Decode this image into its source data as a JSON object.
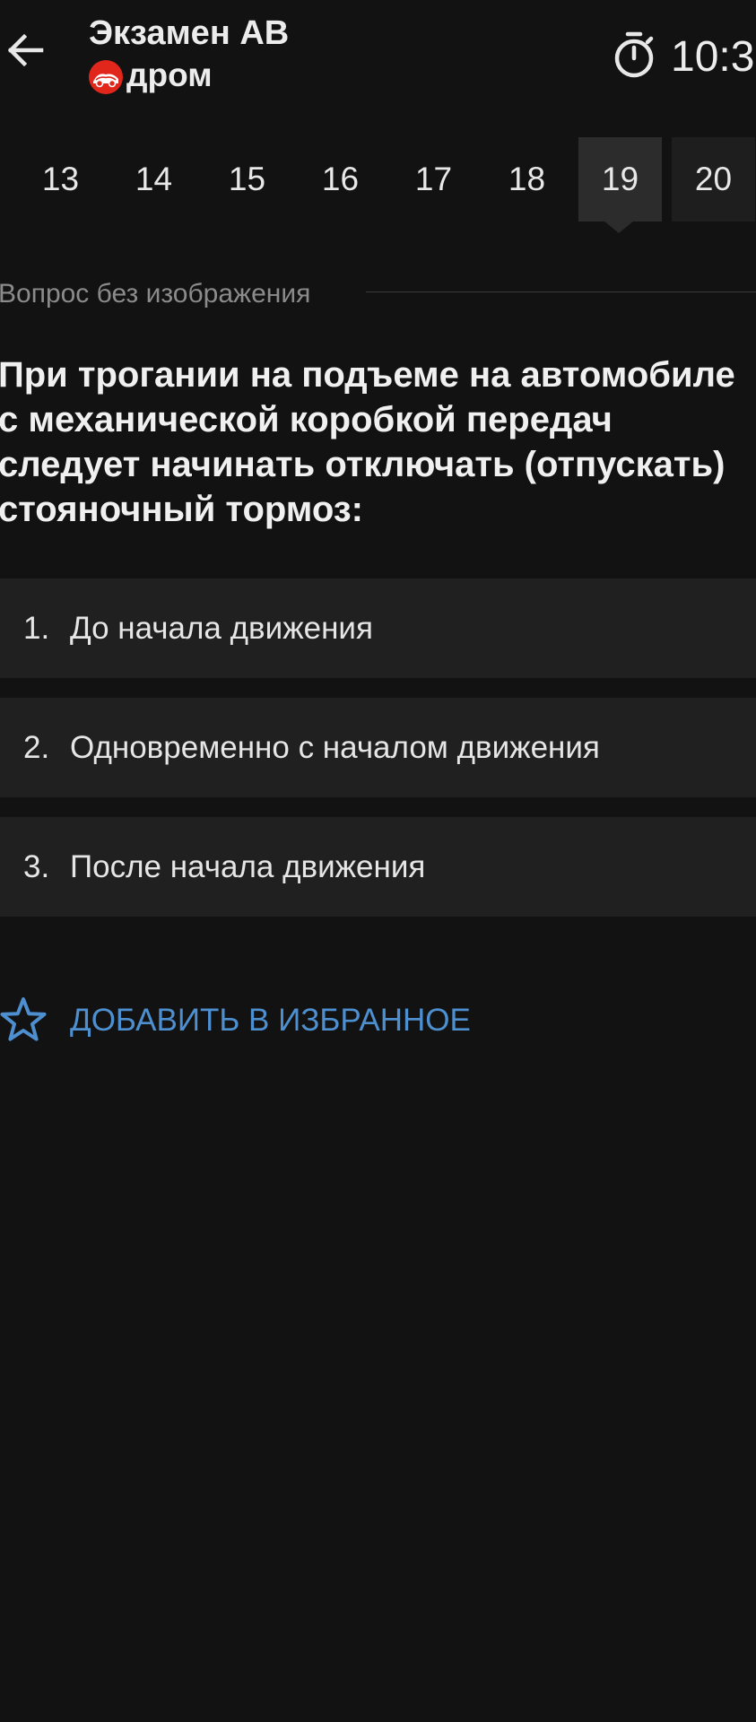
{
  "header": {
    "title": "Экзамен АВ",
    "brand": "дром",
    "timer": "10:3"
  },
  "question_nav": {
    "numbers": [
      "13",
      "14",
      "15",
      "16",
      "17",
      "18",
      "19",
      "20"
    ],
    "active": "19"
  },
  "question": {
    "section_label": "Вопрос без изображения",
    "text": "При трогании на подъеме на автомобиле с механической коробкой передач следует начинать отключать (отпускать) стояночный тормоз:"
  },
  "answers": [
    {
      "number": "1.",
      "text": "До начала движения"
    },
    {
      "number": "2.",
      "text": "Одновременно с началом движения"
    },
    {
      "number": "3.",
      "text": "После начала движения"
    }
  ],
  "favorite": {
    "label": "ДОБАВИТЬ В ИЗБРАННОЕ"
  },
  "colors": {
    "background": "#121212",
    "card": "#202020",
    "active_number": "#2c2c2c",
    "accent": "#4e8fd0",
    "brand_red": "#e1261c"
  },
  "icons": [
    "arrow-back-icon",
    "drom-logo-icon",
    "stopwatch-icon",
    "star-outline-icon"
  ]
}
